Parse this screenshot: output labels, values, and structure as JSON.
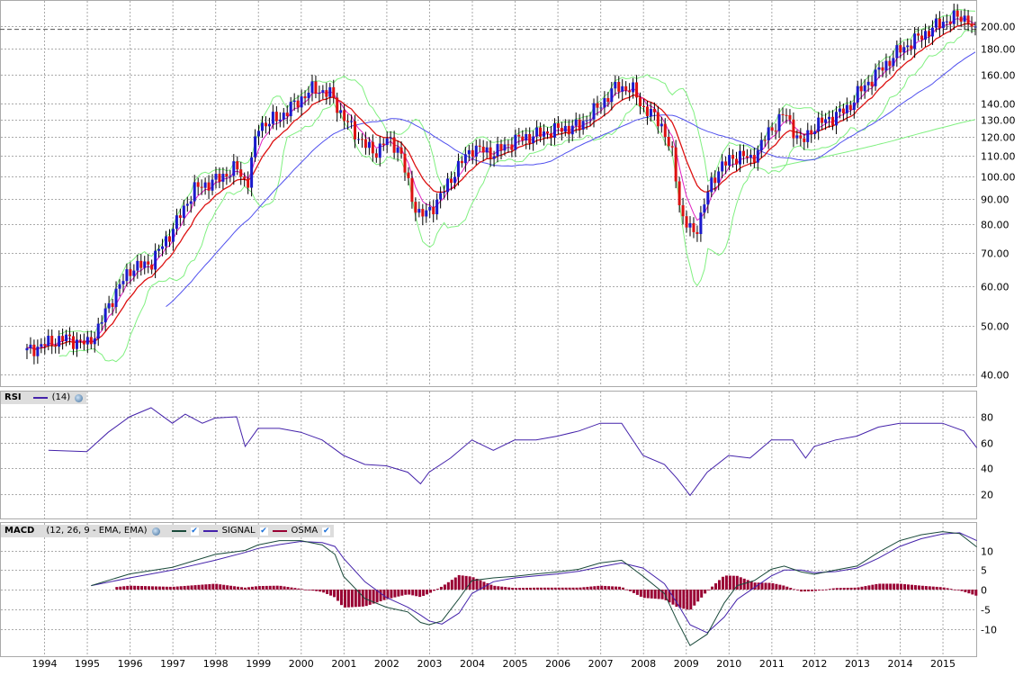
{
  "chart_data": {
    "type": "candlestick",
    "price_panel": {
      "scale": "log",
      "ylim": [
        38,
        215
      ],
      "y_ticks": [
        "200.00",
        "180.00",
        "160.00",
        "140.00",
        "130.00",
        "120.00",
        "110.00",
        "100.00",
        "90.00",
        "80.00",
        "70.00",
        "60.00",
        "50.00",
        "40.00"
      ],
      "y_tick_values": [
        200,
        180,
        160,
        140,
        130,
        120,
        110,
        100,
        90,
        80,
        70,
        60,
        50,
        40
      ],
      "last_price_line": 197,
      "x": [
        1993.6,
        1994.0,
        1994.5,
        1995.0,
        1995.25,
        1995.5,
        1996.0,
        1996.5,
        1997.0,
        1997.5,
        1998.0,
        1998.5,
        1998.75,
        1999.0,
        1999.5,
        2000.0,
        2000.3,
        2000.7,
        2001.0,
        2001.3,
        2001.7,
        2002.0,
        2002.3,
        2002.6,
        2002.8,
        2003.0,
        2003.3,
        2003.6,
        2004.0,
        2004.5,
        2005.0,
        2005.5,
        2006.0,
        2006.5,
        2007.0,
        2007.4,
        2007.8,
        2008.0,
        2008.4,
        2008.7,
        2008.9,
        2009.2,
        2009.5,
        2009.8,
        2010.0,
        2010.3,
        2010.5,
        2010.9,
        2011.3,
        2011.7,
        2012.0,
        2012.4,
        2012.8,
        2013.0,
        2013.5,
        2014.0,
        2014.5,
        2015.0,
        2015.4,
        2015.6,
        2015.7,
        2015.8
      ],
      "close": [
        44.5,
        46,
        47.3,
        46,
        49,
        55,
        65,
        67,
        78,
        94,
        98,
        104,
        96,
        126,
        131,
        143,
        150,
        146,
        131,
        121,
        111,
        118,
        114,
        90,
        83,
        85,
        92,
        102,
        114,
        111,
        118,
        121,
        124,
        126,
        139,
        152,
        148,
        137,
        129,
        109,
        83,
        76,
        92,
        105,
        107,
        111,
        107,
        121,
        134,
        116,
        126,
        131,
        137,
        146,
        162,
        179,
        191,
        204,
        209,
        207,
        195,
        193
      ],
      "colors": {
        "up": "#1a1acc",
        "down": "#dd1111",
        "ema_fast": "#e020c0",
        "ema_slow": "#dd1111",
        "sma_long": "#5050ee",
        "bands": "#80f080",
        "sma_very_long": "#80f080"
      }
    },
    "rsi": {
      "title": "RSI",
      "period_label": "(14)",
      "y_ticks": [
        "80",
        "60",
        "40",
        "20"
      ],
      "y_tick_values": [
        80,
        60,
        40,
        20
      ],
      "color": "#4422aa",
      "x": [
        1994.1,
        1995.0,
        1995.5,
        1996.0,
        1996.5,
        1997.0,
        1997.3,
        1997.7,
        1998.0,
        1998.5,
        1998.7,
        1999.0,
        1999.5,
        2000.0,
        2000.5,
        2001.0,
        2001.5,
        2002.0,
        2002.5,
        2002.8,
        2003.0,
        2003.5,
        2004.0,
        2004.5,
        2005.0,
        2005.5,
        2006.0,
        2006.5,
        2007.0,
        2007.5,
        2008.0,
        2008.5,
        2008.8,
        2009.1,
        2009.5,
        2010.0,
        2010.5,
        2011.0,
        2011.5,
        2011.8,
        2012.0,
        2012.5,
        2013.0,
        2013.5,
        2014.0,
        2014.5,
        2015.0,
        2015.5,
        2015.8
      ],
      "values": [
        54,
        53,
        68,
        80,
        87,
        75,
        82,
        75,
        79,
        80,
        57,
        71,
        71,
        68,
        62,
        50,
        43,
        42,
        37,
        28,
        37,
        48,
        62,
        54,
        62,
        62,
        65,
        69,
        75,
        75,
        50,
        43,
        32,
        19,
        37,
        50,
        48,
        62,
        62,
        48,
        57,
        62,
        65,
        72,
        75,
        75,
        75,
        69,
        56
      ]
    },
    "macd": {
      "title": "MACD",
      "params_label": "(12, 26, 9 - EMA, EMA)",
      "signal_label": "SIGNAL",
      "osma_label": "OSMA",
      "y_ticks": [
        "10",
        "5",
        "0",
        "-5",
        "-10"
      ],
      "y_tick_values": [
        10,
        5,
        0,
        -5,
        -10
      ],
      "colors": {
        "macd": "#1a4a3a",
        "signal": "#4422aa",
        "osma": "#990033"
      },
      "x": [
        1995.1,
        1996.0,
        1997.0,
        1998.0,
        1998.7,
        1999.0,
        1999.5,
        2000.0,
        2000.5,
        2000.8,
        2001.0,
        2001.5,
        2002.0,
        2002.5,
        2002.8,
        2003.0,
        2003.3,
        2003.7,
        2004.0,
        2004.5,
        2005.0,
        2005.5,
        2006.0,
        2006.5,
        2007.0,
        2007.5,
        2008.0,
        2008.5,
        2008.8,
        2009.1,
        2009.5,
        2009.9,
        2010.2,
        2010.6,
        2011.0,
        2011.3,
        2011.7,
        2012.0,
        2012.5,
        2013.0,
        2013.5,
        2014.0,
        2014.5,
        2015.0,
        2015.4,
        2015.8
      ],
      "macd": [
        1,
        4,
        5.7,
        9,
        10,
        11.4,
        12.5,
        12.5,
        11.4,
        9,
        3.4,
        -2.3,
        -4.5,
        -5.7,
        -8.4,
        -9,
        -8,
        -2.3,
        2.3,
        3,
        3.4,
        4,
        4.5,
        5.2,
        6.8,
        7.5,
        3.4,
        -1,
        -8,
        -14.3,
        -11.4,
        -3.4,
        1,
        2.3,
        5.2,
        6,
        4.5,
        3.9,
        5,
        6,
        9.5,
        12.5,
        14,
        14.8,
        14.3,
        10.9
      ],
      "signal": [
        1,
        3,
        5,
        7.5,
        9.5,
        10.5,
        11.5,
        12.3,
        12,
        11,
        8,
        2,
        -2,
        -4.5,
        -6.5,
        -8,
        -8.8,
        -6,
        -1,
        2,
        3,
        3.5,
        4,
        4.7,
        5.8,
        6.8,
        5.5,
        1.5,
        -3.5,
        -9,
        -11,
        -7,
        -2.5,
        0.5,
        3.5,
        5,
        5,
        4.3,
        4.6,
        5.5,
        8,
        11,
        13,
        14.2,
        14.5,
        12.5
      ]
    },
    "x_ticks": [
      "1994",
      "1995",
      "1996",
      "1997",
      "1998",
      "1999",
      "2000",
      "2001",
      "2002",
      "2003",
      "2004",
      "2005",
      "2006",
      "2007",
      "2008",
      "2009",
      "2010",
      "2011",
      "2012",
      "2013",
      "2014",
      "2015"
    ],
    "x_tick_values": [
      1994,
      1995,
      1996,
      1997,
      1998,
      1999,
      2000,
      2001,
      2002,
      2003,
      2004,
      2005,
      2006,
      2007,
      2008,
      2009,
      2010,
      2011,
      2012,
      2013,
      2014,
      2015
    ]
  }
}
